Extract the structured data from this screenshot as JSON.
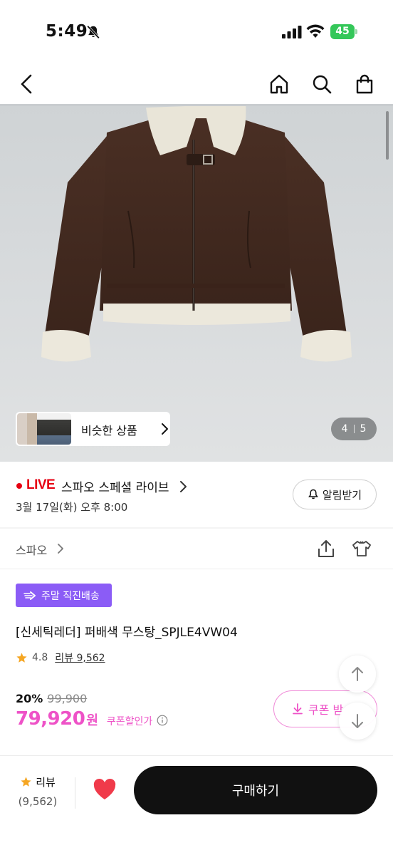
{
  "status_bar": {
    "time": "5:49",
    "battery": "45"
  },
  "nav": {
    "back_icon": "chevron-left-icon",
    "home_icon": "home-icon",
    "search_icon": "search-icon",
    "bag_icon": "shopping-bag-icon"
  },
  "gallery": {
    "similar_label": "비슷한 상품",
    "current_page": "4",
    "total_pages": "5"
  },
  "live": {
    "tag": "LIVE",
    "title": "스파오 스페셜 라이브",
    "date": "3월 17일(화) 오후 8:00",
    "alarm_label": "알림받기"
  },
  "brand": {
    "name": "스파오"
  },
  "product": {
    "badge": "주말 직진배송",
    "title": "[신세틱레더] 퍼배색 무스탕_SPJLE4VW04",
    "rating": "4.8",
    "review_label": "리뷰 9,562",
    "discount_rate": "20%",
    "original_price": "99,900",
    "final_price": "79,920",
    "price_unit": "원",
    "coupon_price_label": "쿠폰할인가",
    "coupon_button_label": "쿠폰 받"
  },
  "bottom": {
    "review_label": "리뷰",
    "review_count": "(9,562)",
    "buy_label": "구매하기"
  },
  "colors": {
    "accent_pink": "#ee52c7",
    "live_red": "#e60012",
    "badge_purple": "#8b5cf6",
    "star": "#f5a623",
    "heart": "#f03a4a"
  }
}
